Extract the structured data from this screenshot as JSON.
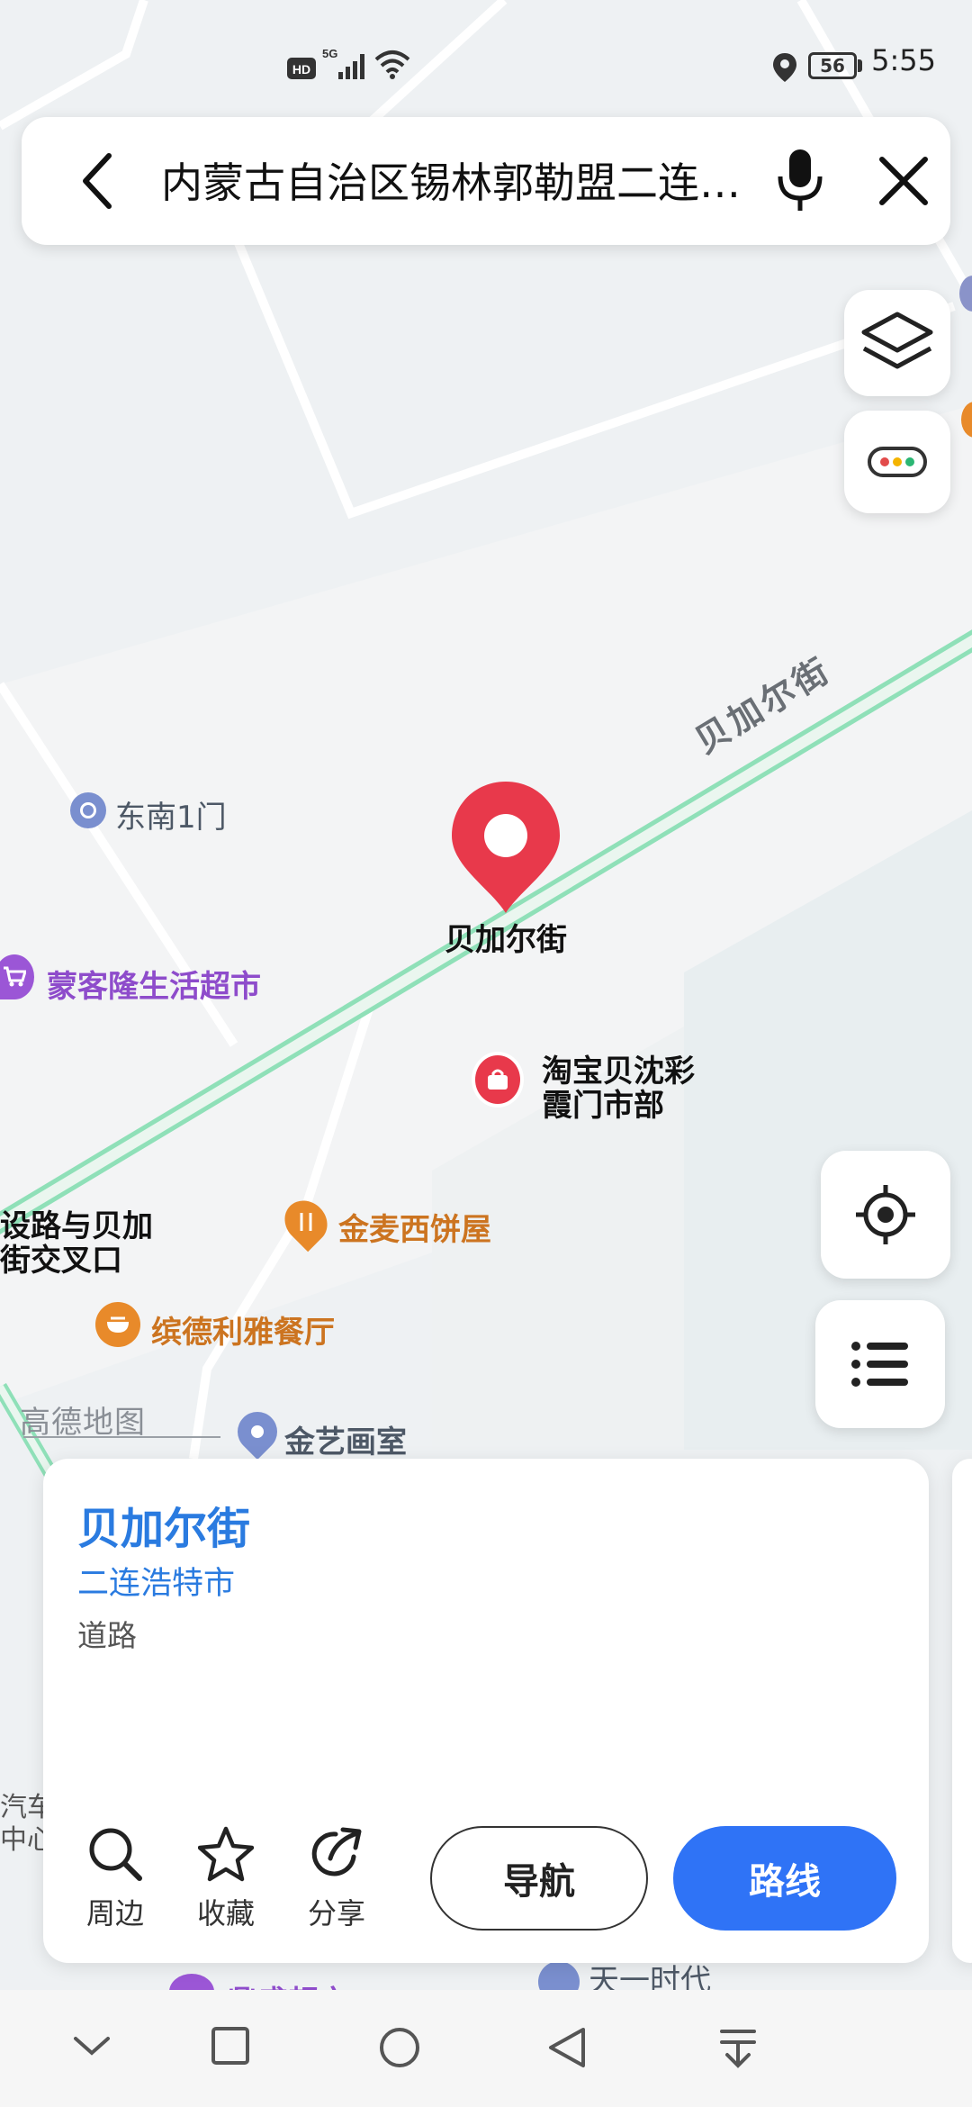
{
  "status_bar": {
    "time": "5:55",
    "battery": "56",
    "icons": [
      "hd-icon",
      "5g-signal-icon",
      "wifi-icon",
      "location-icon",
      "battery-icon"
    ]
  },
  "search": {
    "query": "内蒙古自治区锡林郭勒盟二连浩特市贝加尔街",
    "back_icon": "chevron-left-icon",
    "mic_icon": "microphone-icon",
    "close_icon": "close-icon"
  },
  "map_controls": {
    "layers_icon": "layers-icon",
    "traffic_icon": "traffic-lights-icon",
    "locate_icon": "locate-icon",
    "list_icon": "list-icon"
  },
  "map_labels": {
    "road_name": "贝加尔街",
    "pin_label": "贝加尔街",
    "gate": "东南1门",
    "supermarket": "蒙客隆生活超市",
    "taobao": "淘宝贝沈彩",
    "taobao2": "霞门市部",
    "intersection1": "设路与贝加",
    "intersection2": "街交叉口",
    "bakery": "金麦西饼屋",
    "restaurant": "缤德利雅餐厅",
    "gallery": "金艺画室",
    "watermark": "高德地图",
    "edge_left1": "汽车",
    "edge_left2": "中心",
    "bottom_poi1": "鼎盛超市",
    "bottom_poi2": "天一时代"
  },
  "colors": {
    "accent": "#2f73f6",
    "pin": "#e8394b",
    "road": "#8fe0b8",
    "poi_purple": "#9b56d6",
    "poi_orange": "#e88a2a"
  },
  "place_card": {
    "title": "贝加尔街",
    "city": "二连浩特市",
    "type": "道路",
    "actions": [
      {
        "label": "周边",
        "icon": "search-icon"
      },
      {
        "label": "收藏",
        "icon": "star-icon"
      },
      {
        "label": "分享",
        "icon": "share-icon"
      }
    ],
    "nav_button": "导航",
    "route_button": "路线"
  },
  "nav_bar": {
    "icons": [
      "collapse-icon",
      "recent-apps-icon",
      "home-icon",
      "back-icon",
      "notification-pulldown-icon"
    ]
  }
}
